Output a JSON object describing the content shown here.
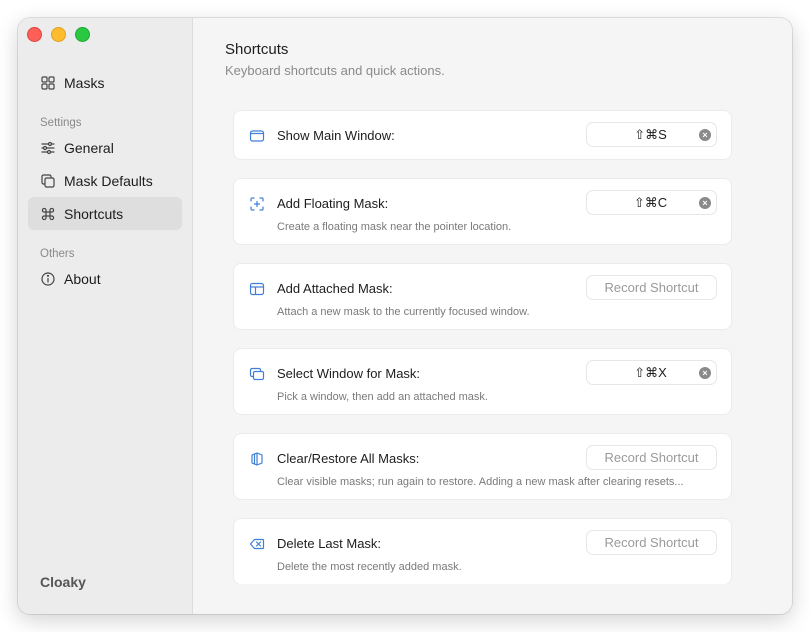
{
  "window": {
    "traffic_lights": {
      "close": "#ff5f57",
      "minimize": "#febc2e",
      "zoom": "#28c840"
    }
  },
  "sidebar": {
    "top_items": [
      {
        "label": "Masks",
        "icon": "grid-icon"
      }
    ],
    "sections": [
      {
        "label": "Settings",
        "items": [
          {
            "label": "General",
            "icon": "sliders-icon"
          },
          {
            "label": "Mask Defaults",
            "icon": "copy-icon"
          },
          {
            "label": "Shortcuts",
            "icon": "command-icon",
            "selected": true
          }
        ]
      },
      {
        "label": "Others",
        "items": [
          {
            "label": "About",
            "icon": "info-icon"
          }
        ]
      }
    ],
    "app_name": "Cloaky"
  },
  "main": {
    "title": "Shortcuts",
    "subtitle": "Keyboard shortcuts and quick actions.",
    "shortcuts": [
      {
        "title": "Show Main Window:",
        "description": "",
        "shortcut": "⇧⌘S",
        "placeholder": "",
        "icon": "window-icon"
      },
      {
        "title": "Add Floating Mask:",
        "description": "Create a floating mask near the pointer location.",
        "shortcut": "⇧⌘C",
        "placeholder": "",
        "icon": "floating-mask-icon"
      },
      {
        "title": "Add Attached Mask:",
        "description": "Attach a new mask to the currently focused window.",
        "shortcut": "",
        "placeholder": "Record Shortcut",
        "icon": "attached-mask-icon"
      },
      {
        "title": "Select Window for Mask:",
        "description": "Pick a window, then add an attached mask.",
        "shortcut": "⇧⌘X",
        "placeholder": "",
        "icon": "select-window-icon"
      },
      {
        "title": "Clear/Restore All Masks:",
        "description": "Clear visible masks; run again to restore. Adding a new mask after clearing resets...",
        "shortcut": "",
        "placeholder": "Record Shortcut",
        "icon": "clear-masks-icon"
      },
      {
        "title": "Delete Last Mask:",
        "description": "Delete the most recently added mask.",
        "shortcut": "",
        "placeholder": "Record Shortcut",
        "icon": "delete-left-icon"
      }
    ],
    "colors": {
      "accent_icon": "#3f7fd8"
    }
  }
}
